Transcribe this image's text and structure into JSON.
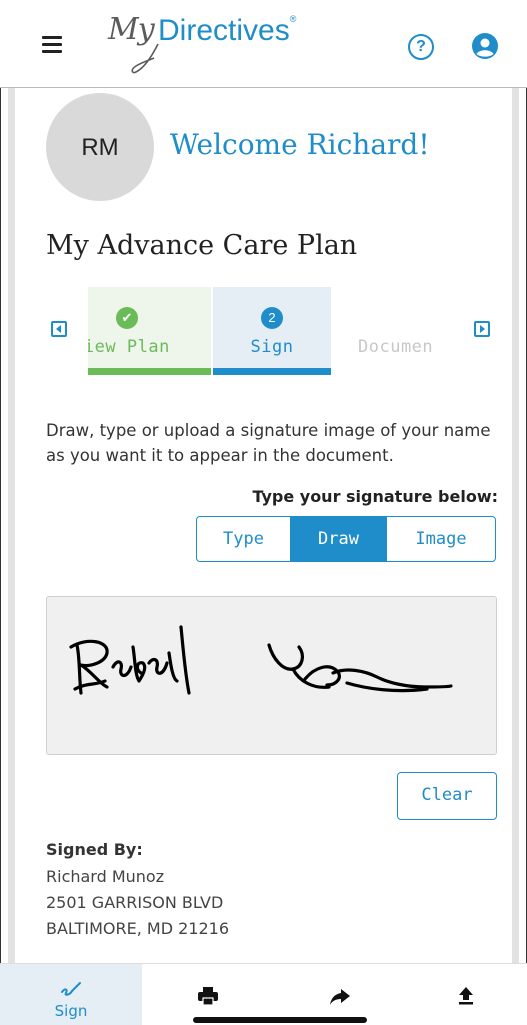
{
  "header": {
    "logo_my": "My",
    "logo_directives": "Directives",
    "logo_reg": "®",
    "help_icon": "question-circle-icon",
    "user_icon": "user-circle-icon",
    "menu_icon": "hamburger-icon"
  },
  "profile": {
    "initials": "RM",
    "welcome": "Welcome Richard!"
  },
  "page": {
    "title": "My Advance Care Plan"
  },
  "stepper": {
    "steps": [
      {
        "label": "view Plan",
        "badge": "✔",
        "status": "complete"
      },
      {
        "label": "Sign",
        "badge": "2",
        "status": "current"
      },
      {
        "label": "Documen",
        "badge": "",
        "status": "upcoming"
      }
    ]
  },
  "sign": {
    "instructions": "Draw, type or upload a signature image of your name as you want it to appear in the document.",
    "heading": "Type your signature below:",
    "modes": [
      "Type",
      "Draw",
      "Image"
    ],
    "selected_mode": "Draw",
    "clear_label": "Clear"
  },
  "signer": {
    "label": "Signed By:",
    "name": "Richard Munoz",
    "address_line1": "2501 GARRISON BLVD",
    "address_line2": "BALTIMORE, MD 21216"
  },
  "tabbar": {
    "items": [
      {
        "label": "Sign",
        "icon": "signature-icon",
        "active": true
      },
      {
        "label": "",
        "icon": "print-icon",
        "active": false
      },
      {
        "label": "",
        "icon": "share-arrow-icon",
        "active": false
      },
      {
        "label": "",
        "icon": "upload-icon",
        "active": false
      }
    ]
  },
  "colors": {
    "accent": "#1f8dc9",
    "complete": "#6cbb59",
    "pad_bg": "#f0f0f0"
  }
}
